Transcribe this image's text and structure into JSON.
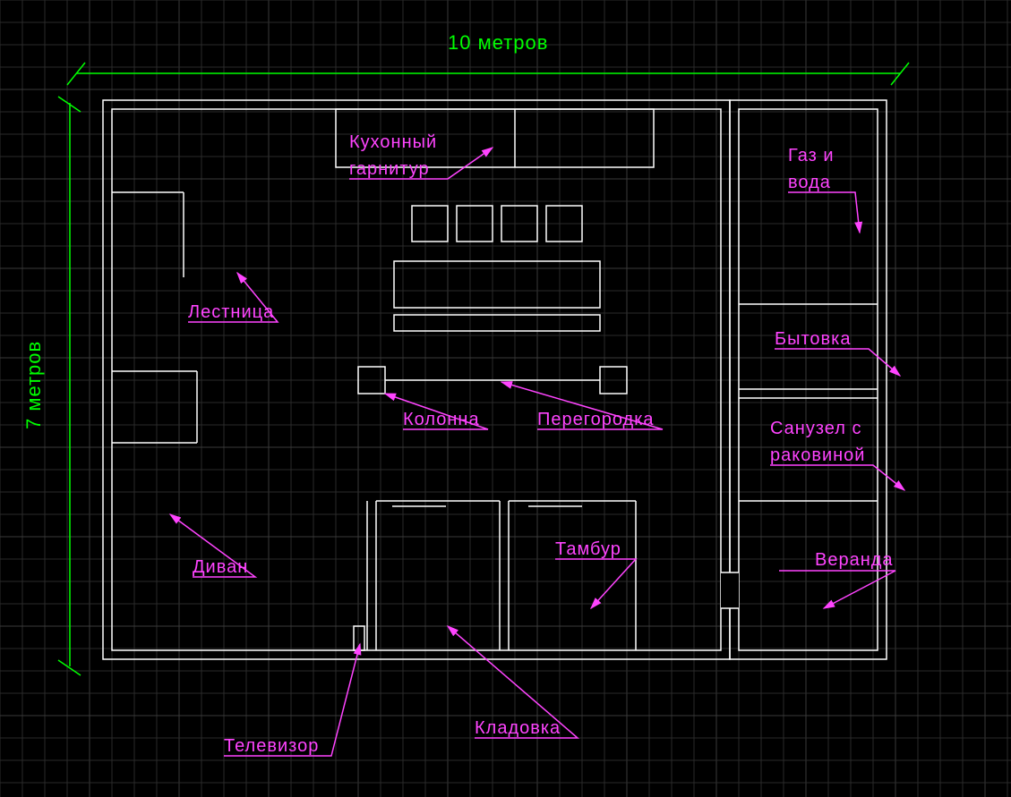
{
  "dimensions": {
    "width_label": "10 метров",
    "height_label": "7 метров"
  },
  "labels": {
    "kitchen": "Кухонный",
    "kitchen2": "гарнитур",
    "gas": "Газ и",
    "gas2": "вода",
    "stairs": "Лестница",
    "utility": "Бытовка",
    "column": "Колонна",
    "partition": "Перегородка",
    "toilet": "Санузел с",
    "toilet2": "раковиной",
    "sofa": "Диван",
    "vestibule": "Тамбур",
    "veranda": "Веранда",
    "tv": "Телевизор",
    "storage": "Кладовка"
  },
  "colors": {
    "grid": "#2a2a2a",
    "dimension": "#00ff00",
    "label": "#ff44ff",
    "wall": "#ffffff"
  }
}
